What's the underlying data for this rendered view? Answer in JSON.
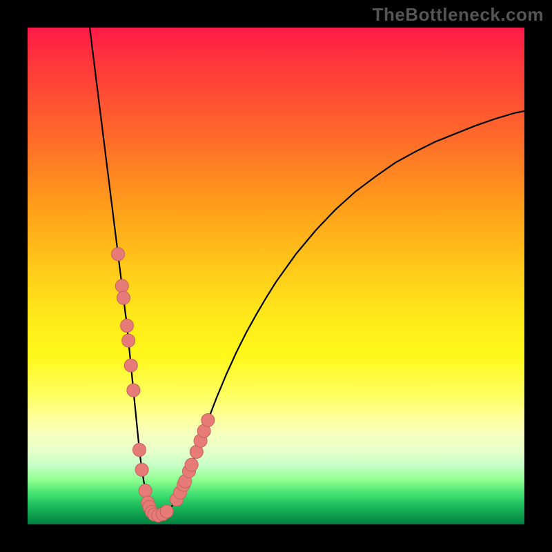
{
  "watermark": "TheBottleneck.com",
  "colors": {
    "curve_stroke": "#000000",
    "marker_fill": "#e77b78",
    "marker_stroke": "#c65f5c"
  },
  "chart_data": {
    "type": "line",
    "title": "",
    "xlabel": "",
    "ylabel": "",
    "xlim": [
      0,
      100
    ],
    "ylim": [
      0,
      100
    ],
    "x": [
      12.5,
      13,
      13.5,
      14,
      14.5,
      15,
      15.5,
      16,
      16.5,
      17,
      17.5,
      18,
      18.5,
      19,
      19.5,
      20,
      20.5,
      21,
      21.5,
      22,
      22.5,
      23,
      23.5,
      24,
      24.5,
      25,
      25.5,
      26,
      26.5,
      27,
      27.5,
      28,
      29,
      30,
      31,
      32,
      33,
      34,
      35,
      36,
      38,
      40,
      42,
      44,
      46,
      48,
      50,
      54,
      58,
      62,
      66,
      70,
      74,
      78,
      82,
      86,
      90,
      94,
      98,
      100
    ],
    "y": [
      100,
      96,
      92,
      88,
      84,
      80,
      76,
      72,
      68,
      64,
      60,
      56,
      52,
      48,
      44,
      40,
      35,
      30,
      25,
      20,
      15,
      11,
      8,
      5,
      3.5,
      2.5,
      2,
      1.8,
      1.8,
      2,
      2.2,
      2.6,
      3.6,
      5,
      7,
      9.4,
      12,
      14.6,
      17.4,
      20.2,
      25.4,
      30.2,
      34.6,
      38.6,
      42.2,
      45.6,
      48.8,
      54.4,
      59.2,
      63.4,
      67,
      70,
      72.8,
      75,
      77,
      78.6,
      80.2,
      81.6,
      82.8,
      83.2
    ],
    "annotated_x": [
      18.2,
      19,
      19.3,
      20,
      20.3,
      20.8,
      21.3,
      22.5,
      23,
      23.7,
      24.2,
      24.5,
      25,
      25.5,
      26.3,
      27.2,
      28,
      30,
      30.7,
      31.4,
      31.7,
      32.5,
      33,
      34,
      34.8,
      35.5,
      36.3
    ]
  }
}
